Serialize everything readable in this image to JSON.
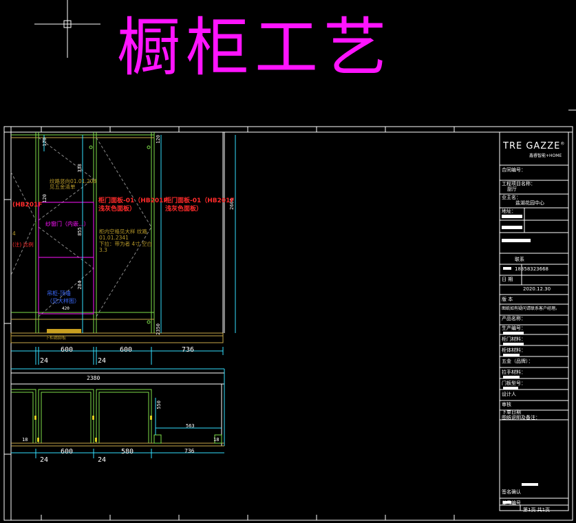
{
  "title": "橱柜工艺",
  "titleblock": {
    "logo": "TRE GAZZE",
    "logo_mark": "®",
    "logo_sub": "鑫睿智能+HOME",
    "rows": [
      "合同编号：",
      "工程项目名称：",
      "厨厅",
      "业主名：",
      "盐湖花园中心",
      "地址：",
      "联系",
      "18358323668",
      "日 期",
      "2020.12.30",
      "版 本",
      "图纸如有疑问请联系客户经理。",
      "产品名称：",
      "生产编号：",
      "柜门材料：",
      "柜体材料：",
      "五金（品牌）：",
      "拉手材料：",
      "门板型号：",
      "设计人",
      "审核",
      "下单日期",
      "图纸说明及备注：",
      "签名确认",
      "单号编号",
      "第1页  共1页"
    ]
  },
  "elevation_dims": {
    "h_top": [
      "600",
      "600",
      "736"
    ],
    "h_gap": [
      "24",
      "24"
    ],
    "v_left": [
      "120",
      "338",
      "120",
      "855",
      "284"
    ],
    "v_right": [
      "120",
      "2350"
    ],
    "v_total": "2600",
    "small": "420"
  },
  "plan_dims": {
    "total": "2380",
    "h_bottom": [
      "600",
      "580",
      "736"
    ],
    "h_gap": [
      "24",
      "24"
    ],
    "depth": "550",
    "inner": "563",
    "side": [
      "18",
      "18"
    ]
  },
  "labels": {
    "door_left": "(HB201F",
    "door_mid": "柜门面板-01（HB201F",
    "door_mid2": "浅灰色面板）",
    "door_right": "柜门面板-01（HB201F",
    "door_right2": "浅灰色面板）",
    "mag_label": "纱窗门（内嵌...）",
    "blue_label": "吊柜-顶墙",
    "blue_label2": "（见大样图）",
    "olive_1": "纹路竖向01.01.208",
    "olive_2": "见五金清单",
    "olive_3": "柜内空格见大样 纹路",
    "olive_4": "01.01.2341",
    "olive_5": "下拉：带为者 4寸 空白",
    "olive_6": "3.3",
    "olive_7": "下柜踢脚板",
    "red_small": "(注) 比例",
    "left_mark": "4"
  }
}
